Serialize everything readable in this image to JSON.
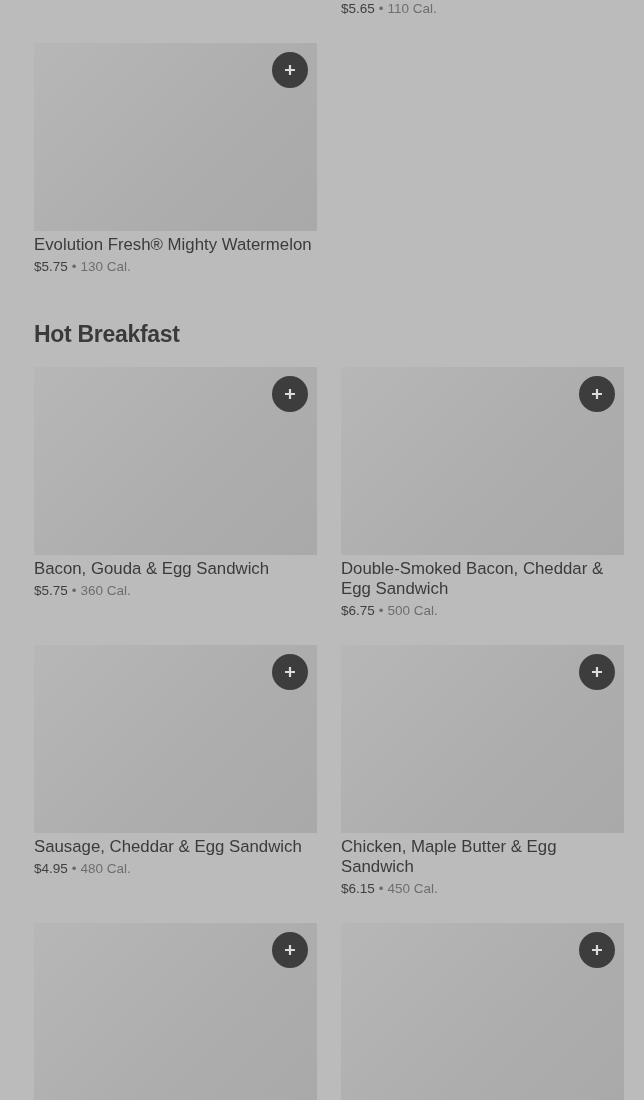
{
  "top_fragment": {
    "price": "$5.65",
    "separator": "•",
    "calories": "110 Cal."
  },
  "sections": [
    {
      "items": [
        {
          "kind": "product",
          "name": "Evolution Fresh® Mighty Watermelon",
          "price": "$5.75",
          "separator": "•",
          "calories": "130 Cal."
        }
      ]
    },
    {
      "title": "Hot Breakfast",
      "items": [
        {
          "kind": "product",
          "name": "Bacon, Gouda & Egg Sandwich",
          "price": "$5.75",
          "separator": "•",
          "calories": "360 Cal."
        },
        {
          "kind": "product",
          "name": "Double-Smoked Bacon, Cheddar & Egg Sandwich",
          "price": "$6.75",
          "separator": "•",
          "calories": "500 Cal."
        },
        {
          "kind": "product",
          "name": "Sausage, Cheddar & Egg Sandwich",
          "price": "$4.95",
          "separator": "•",
          "calories": "480 Cal."
        },
        {
          "kind": "product",
          "name": "Chicken, Maple Butter & Egg Sandwich",
          "price": "$6.15",
          "separator": "•",
          "calories": "450 Cal."
        },
        {
          "kind": "image_only"
        },
        {
          "kind": "image_only"
        }
      ]
    }
  ]
}
